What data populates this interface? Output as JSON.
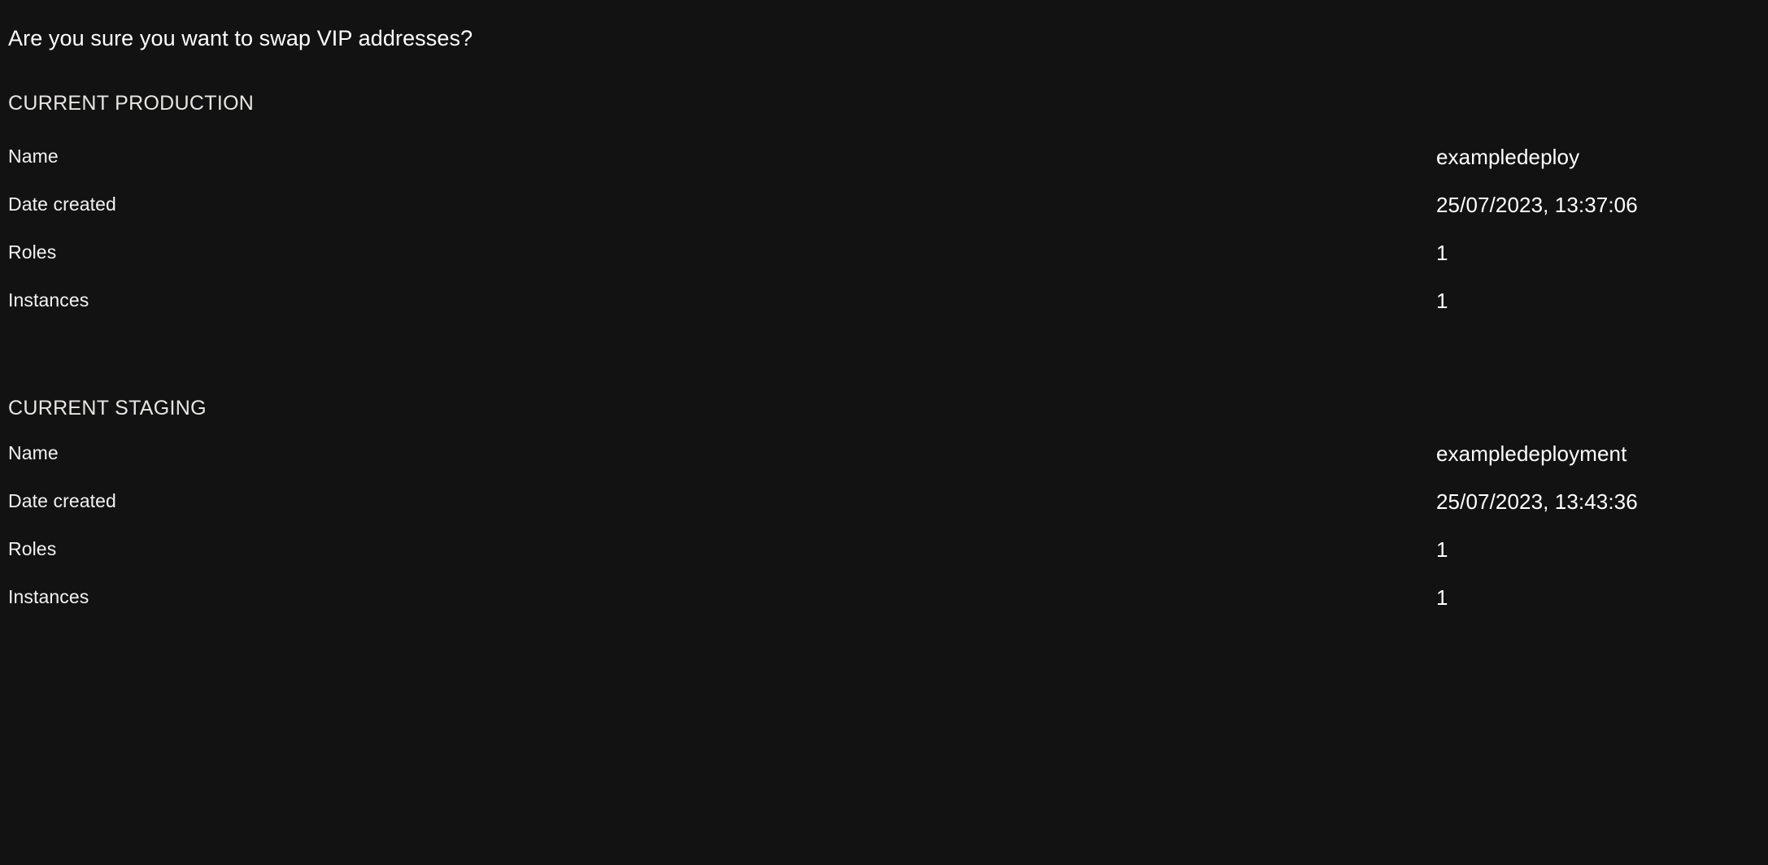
{
  "dialog": {
    "question": "Are you sure you want to swap VIP addresses?",
    "colors": {
      "background": "#121212",
      "primary_text": "#ffffff",
      "secondary_text": "#f3f2f1"
    },
    "sections": [
      {
        "title": "CURRENT PRODUCTION",
        "rows": [
          {
            "label": "Name",
            "value": "exampledeploy"
          },
          {
            "label": "Date created",
            "value": "25/07/2023, 13:37:06"
          },
          {
            "label": "Roles",
            "value": "1"
          },
          {
            "label": "Instances",
            "value": "1"
          }
        ]
      },
      {
        "title": "CURRENT STAGING",
        "rows": [
          {
            "label": "Name",
            "value": "exampledeployment"
          },
          {
            "label": "Date created",
            "value": "25/07/2023, 13:43:36"
          },
          {
            "label": "Roles",
            "value": "1"
          },
          {
            "label": "Instances",
            "value": "1"
          }
        ]
      }
    ]
  }
}
